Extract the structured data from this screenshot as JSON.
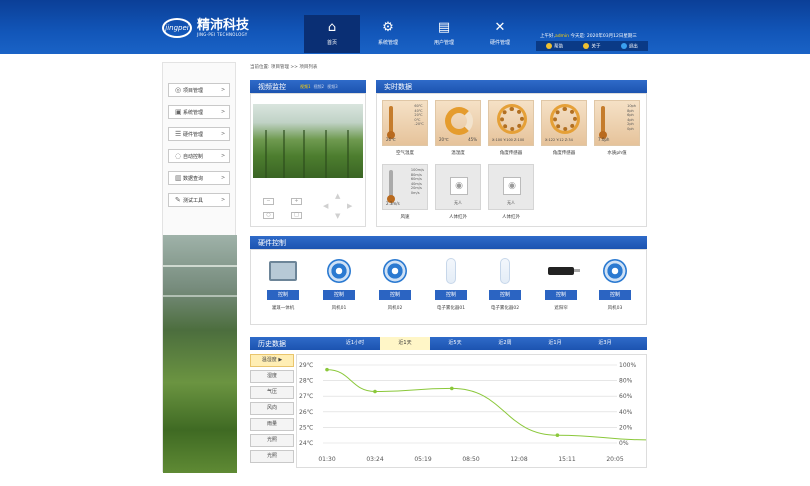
{
  "header": {
    "logo_mark": "jingpei",
    "logo_title": "精沛科技",
    "logo_sub": "JING-PEI TECHNOLOGY",
    "nav": [
      {
        "icon": "home-icon",
        "glyph": "⌂",
        "label": "首页"
      },
      {
        "icon": "system-gear-icon",
        "glyph": "⚙",
        "label": "系统管理"
      },
      {
        "icon": "client-icon",
        "glyph": "▤",
        "label": "用户管理"
      },
      {
        "icon": "tools-icon",
        "glyph": "✕",
        "label": "硬件管理"
      }
    ],
    "user_prefix": "上午好,",
    "user_name": "admin",
    "user_suffix": "  今天是: 2020年03月12日星期三",
    "buttons": [
      "帮助",
      "关于",
      "退出"
    ]
  },
  "breadcrumb": "当前位置: 项目管理 >> 项目列表",
  "sidebar": {
    "items": [
      {
        "icon": "◎",
        "label": "项目管理"
      },
      {
        "icon": "▣",
        "label": "系统管理"
      },
      {
        "icon": "☰",
        "label": "硬件管理"
      },
      {
        "icon": "◌",
        "label": "自动控制"
      },
      {
        "icon": "▥",
        "label": "数据查询"
      },
      {
        "icon": "✎",
        "label": "测试工具"
      }
    ],
    "arrow": ">"
  },
  "video": {
    "title": "视频监控",
    "tabs": [
      "视频1",
      "视频2",
      "视频3"
    ]
  },
  "realtime": {
    "title": "实时数据",
    "sensors": [
      {
        "name": "空气温度",
        "val": "26℃",
        "scale": [
          "60℃",
          "40℃",
          "20℃",
          "0℃",
          "-20℃"
        ]
      },
      {
        "name": "温湿度",
        "val": "20℃",
        "val2": "45%"
      },
      {
        "name": "角度传感器",
        "val": "X:100  Y:100  Z:100"
      },
      {
        "name": "角度传感器",
        "val": "X:122  Y:12  Z:34"
      },
      {
        "name": "水质ph值",
        "val": "7.0ph",
        "scale": [
          "10ph",
          "8ph",
          "6ph",
          "4ph",
          "2ph",
          "0ph"
        ]
      },
      {
        "name": "风速",
        "val": "2.3m/s",
        "scale": [
          "100m/s",
          "80m/s",
          "60m/s",
          "40m/s",
          "20m/s",
          "0m/s"
        ]
      },
      {
        "name": "人体红外",
        "val": "无人",
        "alert": true
      },
      {
        "name": "人体红外",
        "val": "无人",
        "alert": false
      }
    ]
  },
  "hardware": {
    "title": "硬件控制",
    "control_label": "控制",
    "devices": [
      {
        "type": "box",
        "name": "灌溉一体机"
      },
      {
        "type": "fan",
        "name": "风机01"
      },
      {
        "type": "fan",
        "name": "风机02"
      },
      {
        "type": "tube",
        "name": "电子雾化器01"
      },
      {
        "type": "tube",
        "name": "电子雾化器02"
      },
      {
        "type": "motor",
        "name": "遮阳帘"
      },
      {
        "type": "fan",
        "name": "风机03"
      }
    ]
  },
  "history": {
    "title": "历史数据",
    "tabs": [
      "近1小时",
      "近1天",
      "近5天",
      "近2周",
      "近1月",
      "近3月"
    ],
    "active_tab": 1,
    "metrics": [
      "温湿度 ▶",
      "湿度",
      "气压",
      "风向",
      "雨量",
      "光照",
      "光照"
    ],
    "active_metric": 0
  },
  "chart_data": {
    "type": "line",
    "x": [
      "01:30",
      "03:24",
      "05:19",
      "08:50",
      "12:08",
      "15:11",
      "20:05"
    ],
    "y_left_ticks": [
      "29℃",
      "28℃",
      "27℃",
      "26℃",
      "25℃",
      "24℃"
    ],
    "y_right_ticks": [
      "100%",
      "80%",
      "60%",
      "40%",
      "20%",
      "0%"
    ],
    "ylim": [
      24,
      29
    ],
    "series": [
      {
        "color": "#8bc83b",
        "points": [
          [
            0,
            28.7
          ],
          [
            1,
            27.3
          ],
          [
            2.6,
            27.5
          ],
          [
            4.8,
            24.5
          ],
          [
            6.7,
            24.2
          ]
        ]
      }
    ],
    "grid": true
  }
}
